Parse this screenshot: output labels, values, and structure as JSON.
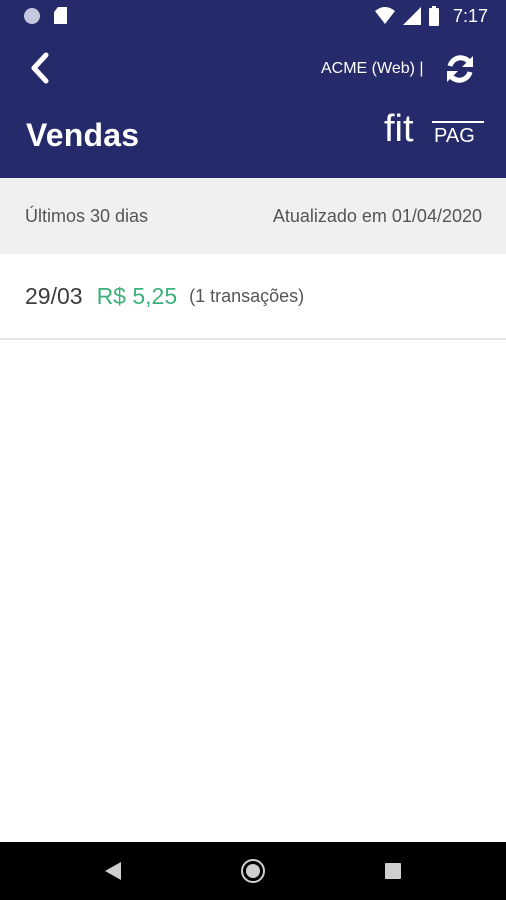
{
  "status_bar": {
    "time": "7:17"
  },
  "app_bar": {
    "account": "ACME (Web) |",
    "title": "Vendas",
    "logo": {
      "text_main": "fit",
      "text_sub": "PAG"
    }
  },
  "period": {
    "range_label": "Últimos 30 dias",
    "updated_label": "Atualizado em 01/04/2020"
  },
  "sales": [
    {
      "date": "29/03",
      "amount": "R$ 5,25",
      "count": "(1 transações)"
    }
  ],
  "colors": {
    "primary": "#252a6a",
    "amount_green": "#3fb07a",
    "period_bg": "#eef0f2",
    "nav_bar": "#000000"
  },
  "icons": {
    "back": "chevron-left-icon",
    "refresh": "sync-icon",
    "wifi": "wifi-icon",
    "signal": "signal-icon",
    "battery": "battery-icon",
    "nav_back": "triangle-back-icon",
    "nav_home": "circle-home-icon",
    "nav_recents": "square-recents-icon"
  }
}
